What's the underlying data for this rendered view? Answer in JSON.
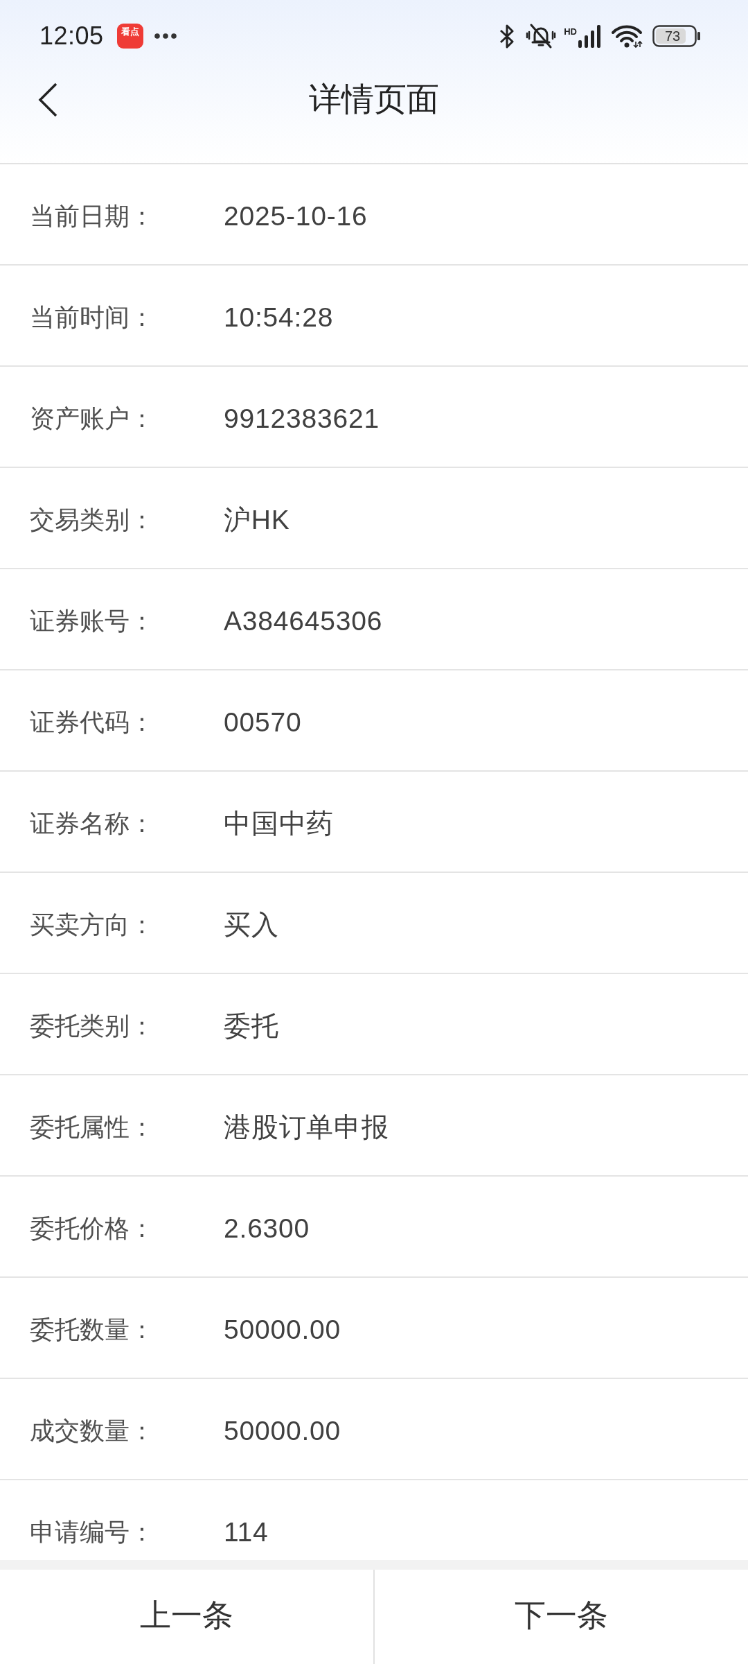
{
  "status_bar": {
    "time": "12:05",
    "app_badge": "看点",
    "network_type": "HD",
    "battery": "73"
  },
  "header": {
    "title": "详情页面"
  },
  "fields": [
    {
      "label": "当前日期：",
      "value": "2025-10-16"
    },
    {
      "label": "当前时间：",
      "value": "10:54:28"
    },
    {
      "label": "资产账户：",
      "value": "9912383621"
    },
    {
      "label": "交易类别：",
      "value": "沪HK"
    },
    {
      "label": "证券账号：",
      "value": "A384645306"
    },
    {
      "label": "证券代码：",
      "value": "00570"
    },
    {
      "label": "证券名称：",
      "value": "中国中药"
    },
    {
      "label": "买卖方向：",
      "value": "买入"
    },
    {
      "label": "委托类别：",
      "value": "委托"
    },
    {
      "label": "委托属性：",
      "value": "港股订单申报"
    },
    {
      "label": "委托价格：",
      "value": "2.6300"
    },
    {
      "label": "委托数量：",
      "value": "50000.00"
    },
    {
      "label": "成交数量：",
      "value": "50000.00"
    },
    {
      "label": "申请编号：",
      "value": "114"
    }
  ],
  "footer": {
    "buttons": [
      {
        "label": "上一条"
      },
      {
        "label": "下一条"
      }
    ]
  }
}
